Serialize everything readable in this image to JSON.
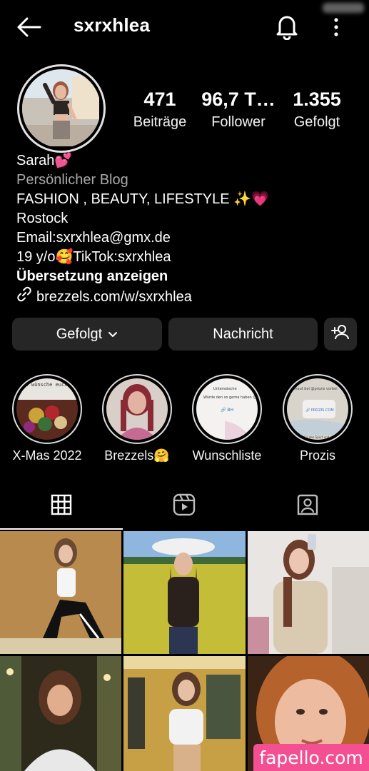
{
  "header": {
    "username": "sxrxhlea"
  },
  "stats": [
    {
      "value": "471",
      "label": "Beiträge"
    },
    {
      "value": "96,7 T…",
      "label": "Follower"
    },
    {
      "value": "1.355",
      "label": "Gefolgt"
    }
  ],
  "bio": {
    "name": "Sarah💕",
    "category": "Persönlicher Blog",
    "lines": [
      "FASHION , BEAUTY, LIFESTYLE ✨💗",
      "Rostock",
      "Email:sxrxhlea@gmx.de",
      "19 y/o🥰TikTok:sxrxhlea"
    ],
    "translate": "Übersetzung anzeigen",
    "link": "brezzels.com/w/sxrxhlea"
  },
  "actions": {
    "following_label": "Gefolgt",
    "message_label": "Nachricht"
  },
  "highlights": [
    {
      "label": "X-Mas 2022",
      "cover_text": "Ich wünsche euch allen frohe Weihnachten"
    },
    {
      "label": "Brezzels🤗"
    },
    {
      "label": "Wunschliste",
      "cover_text": "Unterwäsche",
      "cover_text2": "Würde den so gerne haben 😊",
      "cover_text3": "🔗 BH"
    },
    {
      "label": "Prozis",
      "cover_text": "schaut bei @prozis vorbei",
      "cover_text2": "🔗 PROZIS.COM",
      "cover_text3": "für den Sport und"
    }
  ],
  "tabs": [
    "posts-grid",
    "reels",
    "tagged"
  ],
  "watermark": "fapello.com",
  "colors": {
    "background": "#000000",
    "button": "#262626",
    "secondary_text": "#a8a8a8",
    "watermark": "#f44f93"
  }
}
